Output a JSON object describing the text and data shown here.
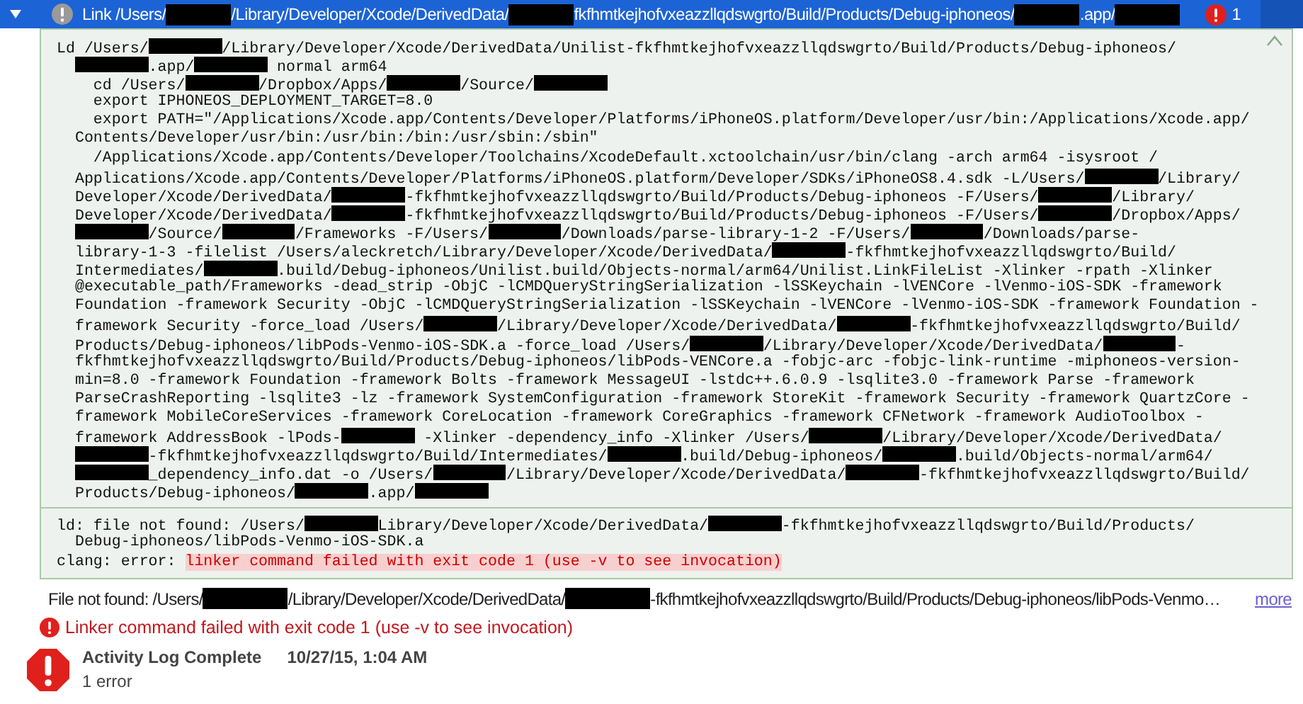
{
  "header": {
    "expanded": true,
    "selected": true,
    "title_parts": [
      "Link /Users/",
      {
        "kind": "redacted"
      },
      "/Library/Developer/Xcode/DerivedData/",
      {
        "kind": "redacted"
      },
      "fkfhmtkejhofvxeazzllqdswgrto/Build/Products/Debug-iphoneos/",
      {
        "kind": "redacted"
      },
      ".app/",
      {
        "kind": "redacted"
      }
    ],
    "issue_count": "1"
  },
  "log": {
    "expanded": true,
    "command_lines": [
      [
        "Ld /Users/",
        {
          "kind": "redacted"
        },
        "/Library/Developer/Xcode/DerivedData/Unilist-fkfhmtkejhofvxeazzllqdswgrto/Build/Products/Debug-iphoneos/"
      ],
      [
        {
          "kind": "indent"
        },
        {
          "kind": "redacted"
        },
        ".app/",
        {
          "kind": "redacted"
        },
        " normal arm64"
      ],
      [
        "    cd /Users/",
        {
          "kind": "redacted"
        },
        "/Dropbox/Apps/",
        {
          "kind": "redacted"
        },
        "/Source/",
        {
          "kind": "redacted"
        }
      ],
      [
        "    export IPHONEOS_DEPLOYMENT_TARGET=8.0"
      ],
      [
        "    export PATH=\"/Applications/Xcode.app/Contents/Developer/Platforms/iPhoneOS.platform/Developer/usr/bin:/Applications/Xcode.app/"
      ],
      [
        "  Contents/Developer/usr/bin:/usr/bin:/bin:/usr/sbin:/sbin\""
      ],
      [
        "    /Applications/Xcode.app/Contents/Developer/Toolchains/XcodeDefault.xctoolchain/usr/bin/clang -arch arm64 -isysroot /"
      ],
      [
        "  Applications/Xcode.app/Contents/Developer/Platforms/iPhoneOS.platform/Developer/SDKs/iPhoneOS8.4.sdk -L/Users/",
        {
          "kind": "redacted"
        },
        "/Library/"
      ],
      [
        "  Developer/Xcode/DerivedData/",
        {
          "kind": "redacted"
        },
        "-fkfhmtkejhofvxeazzllqdswgrto/Build/Products/Debug-iphoneos -F/Users/",
        {
          "kind": "redacted"
        },
        "/Library/"
      ],
      [
        "  Developer/Xcode/DerivedData/",
        {
          "kind": "redacted"
        },
        "-fkfhmtkejhofvxeazzllqdswgrto/Build/Products/Debug-iphoneos -F/Users/",
        {
          "kind": "redacted"
        },
        "/Dropbox/Apps/"
      ],
      [
        {
          "kind": "indent"
        },
        {
          "kind": "redacted"
        },
        "/Source/",
        {
          "kind": "redacted"
        },
        "/Frameworks -F/Users/",
        {
          "kind": "redacted"
        },
        "/Downloads/parse-library-1-2 -F/Users/",
        {
          "kind": "redacted"
        },
        "/Downloads/parse-"
      ],
      [
        "  library-1-3 -filelist /Users/aleckretch/Library/Developer/Xcode/DerivedData/",
        {
          "kind": "redacted"
        },
        "-fkfhmtkejhofvxeazzllqdswgrto/Build/"
      ],
      [
        "  Intermediates/",
        {
          "kind": "redacted"
        },
        ".build/Debug-iphoneos/Unilist.build/Objects-normal/arm64/Unilist.LinkFileList -Xlinker -rpath -Xlinker"
      ],
      [
        "  @executable_path/Frameworks -dead_strip -ObjC -lCMDQueryStringSerialization -lSSKeychain -lVENCore -lVenmo-iOS-SDK -framework"
      ],
      [
        "  Foundation -framework Security -ObjC -lCMDQueryStringSerialization -lSSKeychain -lVENCore -lVenmo-iOS-SDK -framework Foundation -"
      ],
      [
        "  framework Security -force_load /Users/",
        {
          "kind": "redacted"
        },
        "/Library/Developer/Xcode/DerivedData/",
        {
          "kind": "redacted"
        },
        "-fkfhmtkejhofvxeazzllqdswgrto/Build/"
      ],
      [
        "  Products/Debug-iphoneos/libPods-Venmo-iOS-SDK.a -force_load /Users/",
        {
          "kind": "redacted"
        },
        "/Library/Developer/Xcode/DerivedData/",
        {
          "kind": "redacted"
        },
        "-"
      ],
      [
        "  fkfhmtkejhofvxeazzllqdswgrto/Build/Products/Debug-iphoneos/libPods-VENCore.a -fobjc-arc -fobjc-link-runtime -miphoneos-version-"
      ],
      [
        "  min=8.0 -framework Foundation -framework Bolts -framework MessageUI -lstdc++.6.0.9 -lsqlite3.0 -framework Parse -framework"
      ],
      [
        "  ParseCrashReporting -lsqlite3 -lz -framework SystemConfiguration -framework StoreKit -framework Security -framework QuartzCore -"
      ],
      [
        "  framework MobileCoreServices -framework CoreLocation -framework CoreGraphics -framework CFNetwork -framework AudioToolbox -"
      ],
      [
        "  framework AddressBook -lPods-",
        {
          "kind": "redacted"
        },
        " -Xlinker -dependency_info -Xlinker /Users/",
        {
          "kind": "redacted"
        },
        "/Library/Developer/Xcode/DerivedData/"
      ],
      [
        {
          "kind": "indent"
        },
        {
          "kind": "redacted"
        },
        "-fkfhmtkejhofvxeazzllqdswgrto/Build/Intermediates/",
        {
          "kind": "redacted"
        },
        ".build/Debug-iphoneos/",
        {
          "kind": "redacted"
        },
        ".build/Objects-normal/arm64/"
      ],
      [
        {
          "kind": "indent"
        },
        {
          "kind": "redacted"
        },
        "_dependency_info.dat -o /Users/",
        {
          "kind": "redacted"
        },
        "/Library/Developer/Xcode/DerivedData/",
        {
          "kind": "redacted"
        },
        "-fkfhmtkejhofvxeazzllqdswgrto/Build/"
      ],
      [
        "  Products/Debug-iphoneos/",
        {
          "kind": "redacted"
        },
        ".app/",
        {
          "kind": "redacted"
        }
      ]
    ],
    "error_lines": [
      [
        "ld: file not found: /Users/",
        {
          "kind": "redacted"
        },
        "Library/Developer/Xcode/DerivedData/",
        {
          "kind": "redacted"
        },
        "-fkfhmtkejhofvxeazzllqdswgrto/Build/Products/"
      ],
      [
        "  Debug-iphoneos/libPods-Venmo-iOS-SDK.a"
      ],
      [
        "clang: error: ",
        {
          "kind": "highlight",
          "text": "linker command failed with exit code 1 (use -v to see invocation)"
        }
      ]
    ]
  },
  "issues": [
    {
      "kind": "note",
      "parts": [
        "File not found: /Users/",
        {
          "kind": "redacted"
        },
        "/Library/Developer/Xcode/DerivedData/",
        {
          "kind": "redacted"
        },
        "-fkfhmtkejhofvxeazzllqdswgrto/Build/Products/Debug-iphoneos/libPods-Venmo…"
      ],
      "link": "more"
    },
    {
      "kind": "error",
      "parts": [
        "Linker command failed with exit code 1 (use -v to see invocation)"
      ]
    }
  ],
  "summary": {
    "title": "Activity Log Complete",
    "time": "10/27/15, 1:04 AM",
    "detail": "1 error"
  }
}
